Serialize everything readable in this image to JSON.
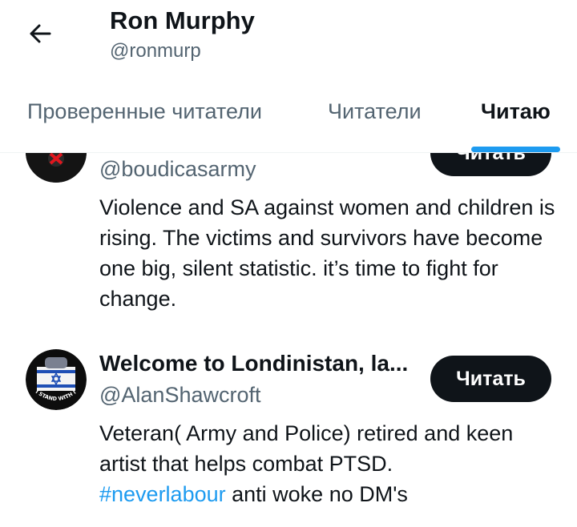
{
  "header": {
    "title": "Ron Murphy",
    "handle": "@ronmurp"
  },
  "tabs": [
    {
      "label": "Проверенные читатели",
      "active": false
    },
    {
      "label": "Читатели",
      "active": false
    },
    {
      "label": "Читаю",
      "active": true
    }
  ],
  "users": [
    {
      "name": "",
      "handle": "@boudicasarmy",
      "bio": "Violence and SA against women and children is rising. The victims and survivors have become one big, silent statistic. it’s time to fight for change.",
      "button": "Читать"
    },
    {
      "name": "Welcome to Londinistan, la...",
      "handle": "@AlanShawcroft",
      "bio_before": "Veteran( Army and Police) retired and keen artist that helps combat PTSD.",
      "bio_tag": "#neverlabour",
      "bio_after": " anti woke no DM's",
      "button": "Читать",
      "avatar_text": "I STAND WITH ISRAEL"
    }
  ],
  "colors": {
    "accent": "#1d9bf0",
    "button_bg": "#0f1419",
    "secondary_text": "#536471"
  }
}
